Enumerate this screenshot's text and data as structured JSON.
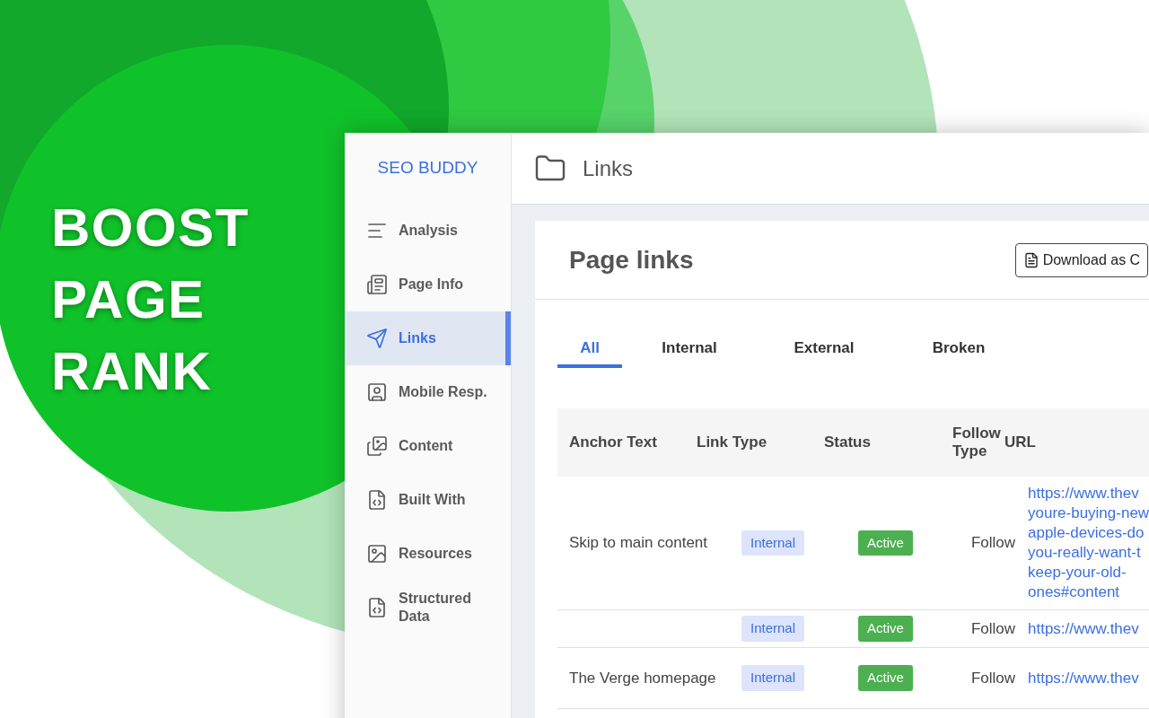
{
  "headline": "BOOST PAGE RANK",
  "app": {
    "brand": "SEO BUDDY",
    "sidebar": {
      "items": [
        {
          "label": "Analysis",
          "selected": false
        },
        {
          "label": "Page Info",
          "selected": false
        },
        {
          "label": "Links",
          "selected": true
        },
        {
          "label": "Mobile Resp.",
          "selected": false
        },
        {
          "label": "Content",
          "selected": false
        },
        {
          "label": "Built With",
          "selected": false
        },
        {
          "label": "Resources",
          "selected": false
        },
        {
          "label": "Structured Data",
          "selected": false
        }
      ]
    },
    "header": {
      "title": "Links"
    },
    "card": {
      "title": "Page links",
      "download_button": "Download as C",
      "tabs": [
        {
          "label": "All",
          "selected": true
        },
        {
          "label": "Internal",
          "selected": false
        },
        {
          "label": "External",
          "selected": false
        },
        {
          "label": "Broken",
          "selected": false
        }
      ],
      "table": {
        "columns": [
          "Anchor Text",
          "Link Type",
          "Status",
          "Follow Type",
          "URL"
        ],
        "rows": [
          {
            "anchor": "Skip to main content",
            "link_type": "Internal",
            "status": "Active",
            "follow": "Follow",
            "url": "https://www.thev youre-buying-new apple-devices-do you-really-want-t keep-your-old- ones#content"
          },
          {
            "anchor": "",
            "link_type": "Internal",
            "status": "Active",
            "follow": "Follow",
            "url": "https://www.thev"
          },
          {
            "anchor": "The Verge homepage",
            "link_type": "Internal",
            "status": "Active",
            "follow": "Follow",
            "url": "https://www.thev"
          }
        ]
      }
    }
  }
}
